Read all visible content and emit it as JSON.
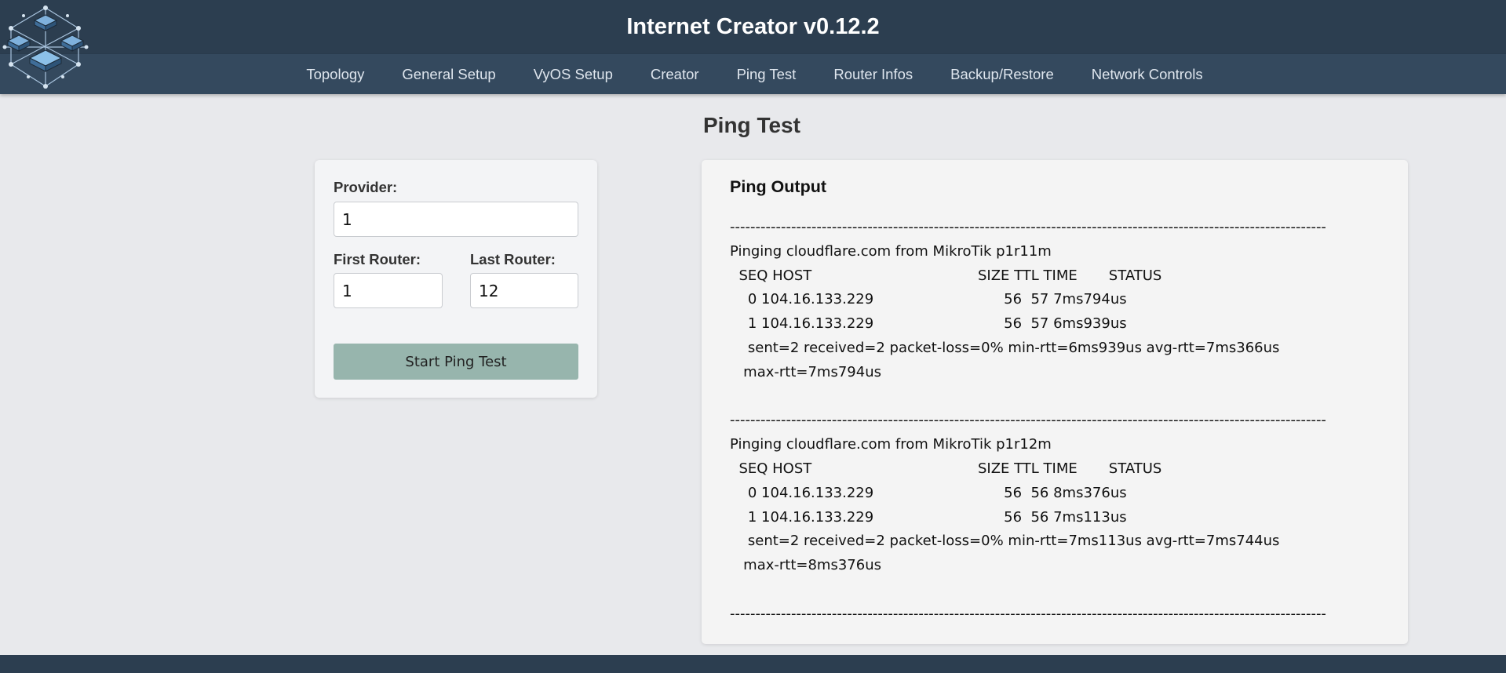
{
  "app": {
    "title": "Internet Creator v0.12.2"
  },
  "nav": {
    "items": [
      "Topology",
      "General Setup",
      "VyOS Setup",
      "Creator",
      "Ping Test",
      "Router Infos",
      "Backup/Restore",
      "Network Controls"
    ]
  },
  "page": {
    "title": "Ping Test"
  },
  "form": {
    "provider_label": "Provider:",
    "provider_value": "1",
    "first_router_label": "First Router:",
    "first_router_value": "1",
    "last_router_label": "Last Router:",
    "last_router_value": "12",
    "start_button": "Start Ping Test"
  },
  "output": {
    "title": "Ping Output",
    "text": "------------------------------------------------------------------------------------------------------------------------\nPinging cloudflare.com from MikroTik p1r11m\n  SEQ HOST                                     SIZE TTL TIME       STATUS\n    0 104.16.133.229                             56  57 7ms794us\n    1 104.16.133.229                             56  57 6ms939us\n    sent=2 received=2 packet-loss=0% min-rtt=6ms939us avg-rtt=7ms366us\n   max-rtt=7ms794us\n\n------------------------------------------------------------------------------------------------------------------------\nPinging cloudflare.com from MikroTik p1r12m\n  SEQ HOST                                     SIZE TTL TIME       STATUS\n    0 104.16.133.229                             56  56 8ms376us\n    1 104.16.133.229                             56  56 7ms113us\n    sent=2 received=2 packet-loss=0% min-rtt=7ms113us avg-rtt=7ms744us\n   max-rtt=8ms376us\n\n------------------------------------------------------------------------------------------------------------------------"
  },
  "colors": {
    "header_bg": "#2c3e50",
    "nav_bg": "#34495e",
    "page_bg": "#e8e9ec",
    "button_bg": "#97b5ad"
  },
  "icons": {
    "logo": "network-routers-logo-icon"
  }
}
